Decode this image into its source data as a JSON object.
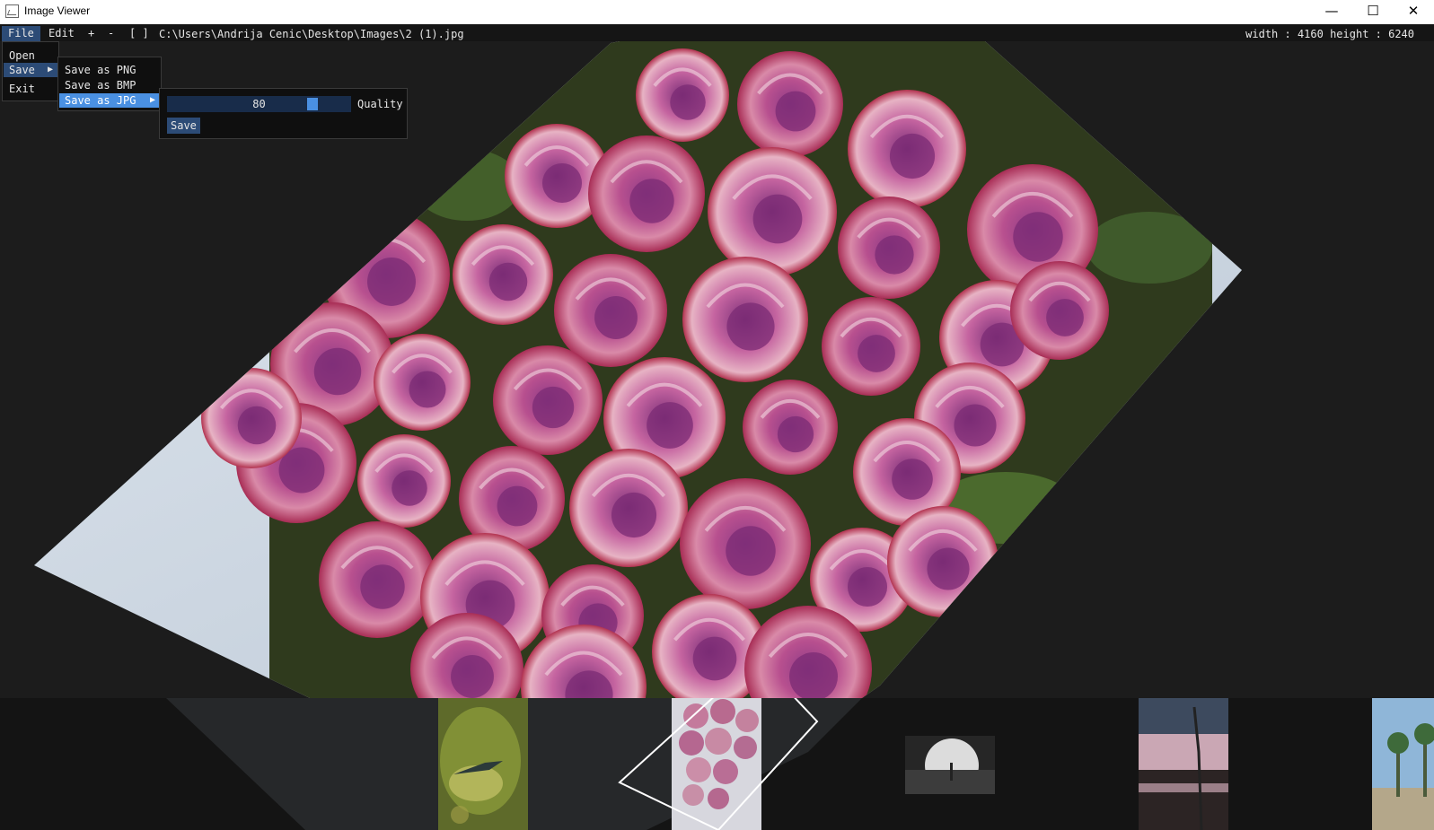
{
  "window": {
    "title": "Image Viewer",
    "minimize_glyph": "—",
    "maximize_glyph": "☐",
    "close_glyph": "✕"
  },
  "menubar": {
    "file": "File",
    "edit": "Edit",
    "zoom_in": "+",
    "zoom_out": "-",
    "fit": "[ ]",
    "path": "C:\\Users\\Andrija Cenic\\Desktop\\Images\\2 (1).jpg",
    "dimensions": "width : 4160 height : 6240"
  },
  "file_menu": {
    "items": [
      "Open",
      "Save",
      "Exit"
    ],
    "arrow": "▶"
  },
  "save_menu": {
    "items": [
      "Save as PNG",
      "Save as BMP",
      "Save as JPG"
    ],
    "arrow": "▶"
  },
  "jpg_options": {
    "quality_value": "80",
    "quality_label": "Quality",
    "save_label": "Save"
  },
  "colors": {
    "menu_highlight": "#2c4b76",
    "selected": "#4a90e2",
    "background": "#1c1c1c"
  },
  "icons": [
    "image-viewer-app-icon",
    "minimize-icon",
    "maximize-icon",
    "close-icon",
    "submenu-arrow-icon"
  ]
}
